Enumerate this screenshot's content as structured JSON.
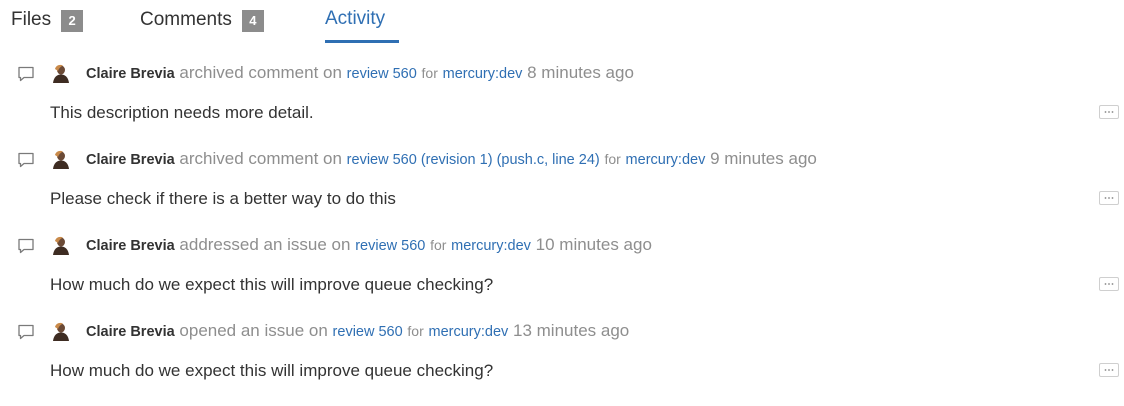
{
  "tabs": {
    "files": {
      "label": "Files",
      "count": "2"
    },
    "comments": {
      "label": "Comments",
      "count": "4"
    },
    "activity": {
      "label": "Activity"
    }
  },
  "activity": [
    {
      "user": "Claire Brevia",
      "action": "archived comment on",
      "review_link": "review 560",
      "detail": "",
      "for_text": "for",
      "project": "mercury:dev",
      "time": "8 minutes ago",
      "body": "This description needs more detail."
    },
    {
      "user": "Claire Brevia",
      "action": "archived comment on",
      "review_link": "review 560 (revision 1) (push.c, line 24)",
      "detail": "",
      "for_text": "for",
      "project": "mercury:dev",
      "time": "9 minutes ago",
      "body": "Please check if there is a better way to do this"
    },
    {
      "user": "Claire Brevia",
      "action": "addressed an issue on",
      "review_link": "review 560",
      "detail": "",
      "for_text": "for",
      "project": "mercury:dev",
      "time": "10 minutes ago",
      "body": "How much do we expect this will improve queue checking?"
    },
    {
      "user": "Claire Brevia",
      "action": "opened an issue on",
      "review_link": "review 560",
      "detail": "",
      "for_text": "for",
      "project": "mercury:dev",
      "time": "13 minutes ago",
      "body": "How much do we expect this will improve queue checking?"
    }
  ],
  "icons": {
    "comment": "comment-icon",
    "avatar": "avatar",
    "more": "ellipsis-icon"
  },
  "colors": {
    "link": "#2f6fb3",
    "muted": "#8e8e8e",
    "text": "#333333",
    "badge": "#8c8c8c"
  }
}
